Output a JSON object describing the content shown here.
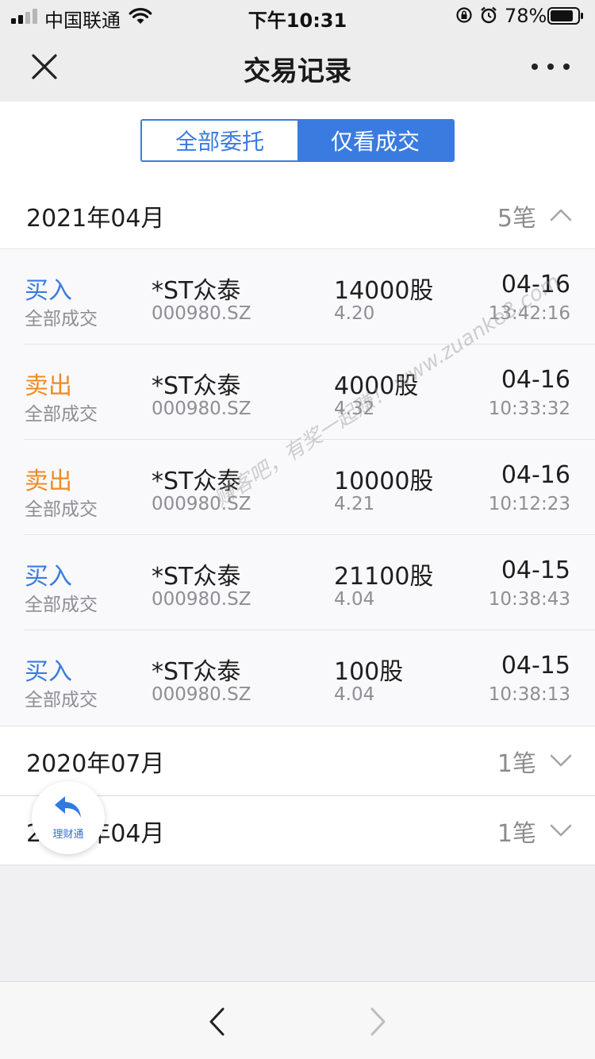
{
  "status_bar": {
    "carrier": "中国联通",
    "time": "下午10:31",
    "battery": "78%"
  },
  "nav": {
    "title": "交易记录",
    "close_icon": "close-icon",
    "more_icon": "more-dots-icon"
  },
  "tabs": [
    {
      "label": "全部委托",
      "active": false
    },
    {
      "label": "仅看成交",
      "active": true
    }
  ],
  "groups": [
    {
      "title": "2021年04月",
      "count": "5笔",
      "expanded": true
    },
    {
      "title": "2020年07月",
      "count": "1笔",
      "expanded": false
    },
    {
      "title": "2020年04月",
      "count": "1笔",
      "expanded": false
    }
  ],
  "trades": [
    {
      "side": "买入",
      "status": "全部成交",
      "name": "*ST众泰",
      "code": "000980.SZ",
      "qty": "14000股",
      "price": "4.20",
      "date": "04-16",
      "time": "13:42:16"
    },
    {
      "side": "卖出",
      "status": "全部成交",
      "name": "*ST众泰",
      "code": "000980.SZ",
      "qty": "4000股",
      "price": "4.32",
      "date": "04-16",
      "time": "10:33:32"
    },
    {
      "side": "卖出",
      "status": "全部成交",
      "name": "*ST众泰",
      "code": "000980.SZ",
      "qty": "10000股",
      "price": "4.21",
      "date": "04-16",
      "time": "10:12:23"
    },
    {
      "side": "买入",
      "status": "全部成交",
      "name": "*ST众泰",
      "code": "000980.SZ",
      "qty": "21100股",
      "price": "4.04",
      "date": "04-15",
      "time": "10:38:43"
    },
    {
      "side": "买入",
      "status": "全部成交",
      "name": "*ST众泰",
      "code": "000980.SZ",
      "qty": "100股",
      "price": "4.04",
      "date": "04-15",
      "time": "10:38:13"
    }
  ],
  "float_button": {
    "label": "理财通",
    "icon": "reply-arrow-icon"
  },
  "watermark": "赚客吧，有奖一起赚！ www.zuanke8.com",
  "colors": {
    "accent": "#3a7be0",
    "buy": "#3a7be0",
    "sell": "#f08a24"
  }
}
